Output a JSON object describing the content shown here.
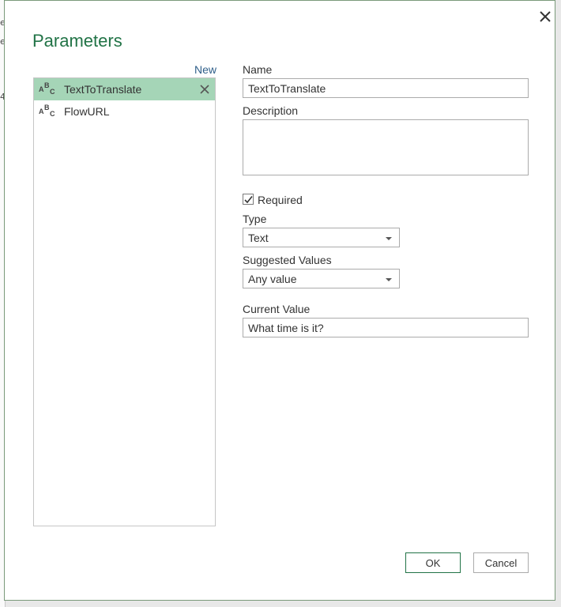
{
  "background": {
    "fragments": [
      "e",
      "e",
      "4"
    ]
  },
  "dialog": {
    "title": "Parameters",
    "new_link": "New",
    "parameters": [
      {
        "name": "TextToTranslate",
        "type_icon": "abc-text-icon",
        "selected": true
      },
      {
        "name": "FlowURL",
        "type_icon": "abc-text-icon",
        "selected": false
      }
    ],
    "form": {
      "name_label": "Name",
      "name_value": "TextToTranslate",
      "description_label": "Description",
      "description_value": "",
      "required_label": "Required",
      "required_checked": true,
      "type_label": "Type",
      "type_value": "Text",
      "suggested_label": "Suggested Values",
      "suggested_value": "Any value",
      "current_label": "Current Value",
      "current_value": "What time is it?"
    },
    "buttons": {
      "ok": "OK",
      "cancel": "Cancel"
    },
    "colors": {
      "accent": "#217346",
      "selected_row": "#a5d5b7",
      "link": "#2f5f8a"
    }
  }
}
